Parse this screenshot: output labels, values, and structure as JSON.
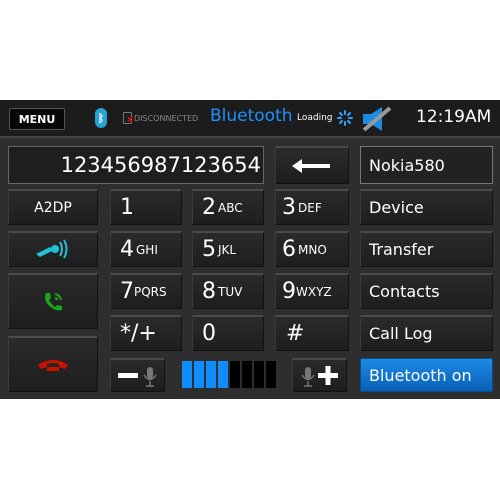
{
  "topbar": {
    "menu_label": "MENU",
    "bluetooth_icon": "bluetooth-icon",
    "connection_status": "DISCONNECTED",
    "title": "Bluetooth",
    "loading_label": "Loading",
    "time": "12:19AM"
  },
  "dialer": {
    "number": "123456987123654",
    "keys": [
      {
        "digit": "1",
        "letters": ""
      },
      {
        "digit": "2",
        "letters": "ABC"
      },
      {
        "digit": "3",
        "letters": "DEF"
      },
      {
        "digit": "4",
        "letters": "GHI"
      },
      {
        "digit": "5",
        "letters": "JKL"
      },
      {
        "digit": "6",
        "letters": "MNO"
      },
      {
        "digit": "7",
        "letters": "PQRS"
      },
      {
        "digit": "8",
        "letters": "TUV"
      },
      {
        "digit": "9",
        "letters": "WXYZ"
      },
      {
        "digit": "*/+",
        "letters": ""
      },
      {
        "digit": "0",
        "letters": ""
      },
      {
        "digit": "#",
        "letters": ""
      }
    ],
    "backspace_icon": "backspace-arrow-icon"
  },
  "left": {
    "a2dp_label": "A2DP"
  },
  "right": {
    "device_name": "Nokia580",
    "items": [
      "Device",
      "Transfer",
      "Contacts",
      "Call Log"
    ],
    "bluetooth_toggle": "Bluetooth on"
  },
  "volume": {
    "level": 4,
    "max": 8
  },
  "colors": {
    "accent": "#1e90ff",
    "call_green": "#1aa51a",
    "hangup_red": "#cc1100",
    "cyan_icon": "#1fc2d6"
  }
}
